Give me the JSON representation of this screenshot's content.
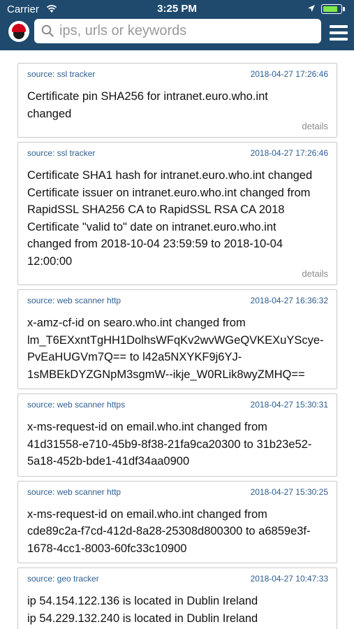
{
  "status_bar": {
    "carrier": "Carrier",
    "time": "3:25 PM"
  },
  "search": {
    "placeholder": "ips, urls or keywords"
  },
  "colors": {
    "header_bg": "#1f4a6e",
    "source_text": "#2d5f8f",
    "battery_green": "#7ee84a",
    "logo_red": "#d0021b"
  },
  "feed": {
    "items": [
      {
        "source": "source: ssl tracker",
        "timestamp": "2018-04-27 17:26:46",
        "message": "Certificate pin SHA256 for intranet.euro.who.int\nchanged",
        "details": "details"
      },
      {
        "source": "source: ssl tracker",
        "timestamp": "2018-04-27 17:26:46",
        "message": "Certificate SHA1 hash for intranet.euro.who.int changed\nCertificate issuer on intranet.euro.who.int changed from\nRapidSSL SHA256 CA to RapidSSL RSA CA 2018\nCertificate \"valid to\" date on intranet.euro.who.int\nchanged from 2018-10-04 23:59:59 to 2018-10-04\n12:00:00",
        "details": "details"
      },
      {
        "source": "source: web scanner http",
        "timestamp": "2018-04-27 16:36:32",
        "message": "x-amz-cf-id on searo.who.int changed from\nlm_T6EXxntTgHH1DolhsWFqKv2wvWGeQVKEXuYScye-\nPvEaHUGVm7Q== to l42a5NXYKF9j6YJ-\n1sMBEkDYZGNpM3sgmW--ikje_W0RLik8wyZMHQ=="
      },
      {
        "source": "source: web scanner https",
        "timestamp": "2018-04-27 15:30:31",
        "message": "x-ms-request-id on email.who.int changed from\n41d31558-e710-45b9-8f38-21fa9ca20300 to 31b23e52-\n5a18-452b-bde1-41df34aa0900"
      },
      {
        "source": "source: web scanner http",
        "timestamp": "2018-04-27 15:30:25",
        "message": "x-ms-request-id on email.who.int changed from\ncde89c2a-f7cd-412d-8a28-25308d800300 to a6859e3f-\n1678-4cc1-8003-60fc33c10900"
      },
      {
        "source": "source: geo tracker",
        "timestamp": "2018-04-27 10:47:33",
        "message": "ip 54.154.122.136 is located in Dublin Ireland\nip 54.229.132.240 is located in Dublin Ireland"
      }
    ]
  }
}
